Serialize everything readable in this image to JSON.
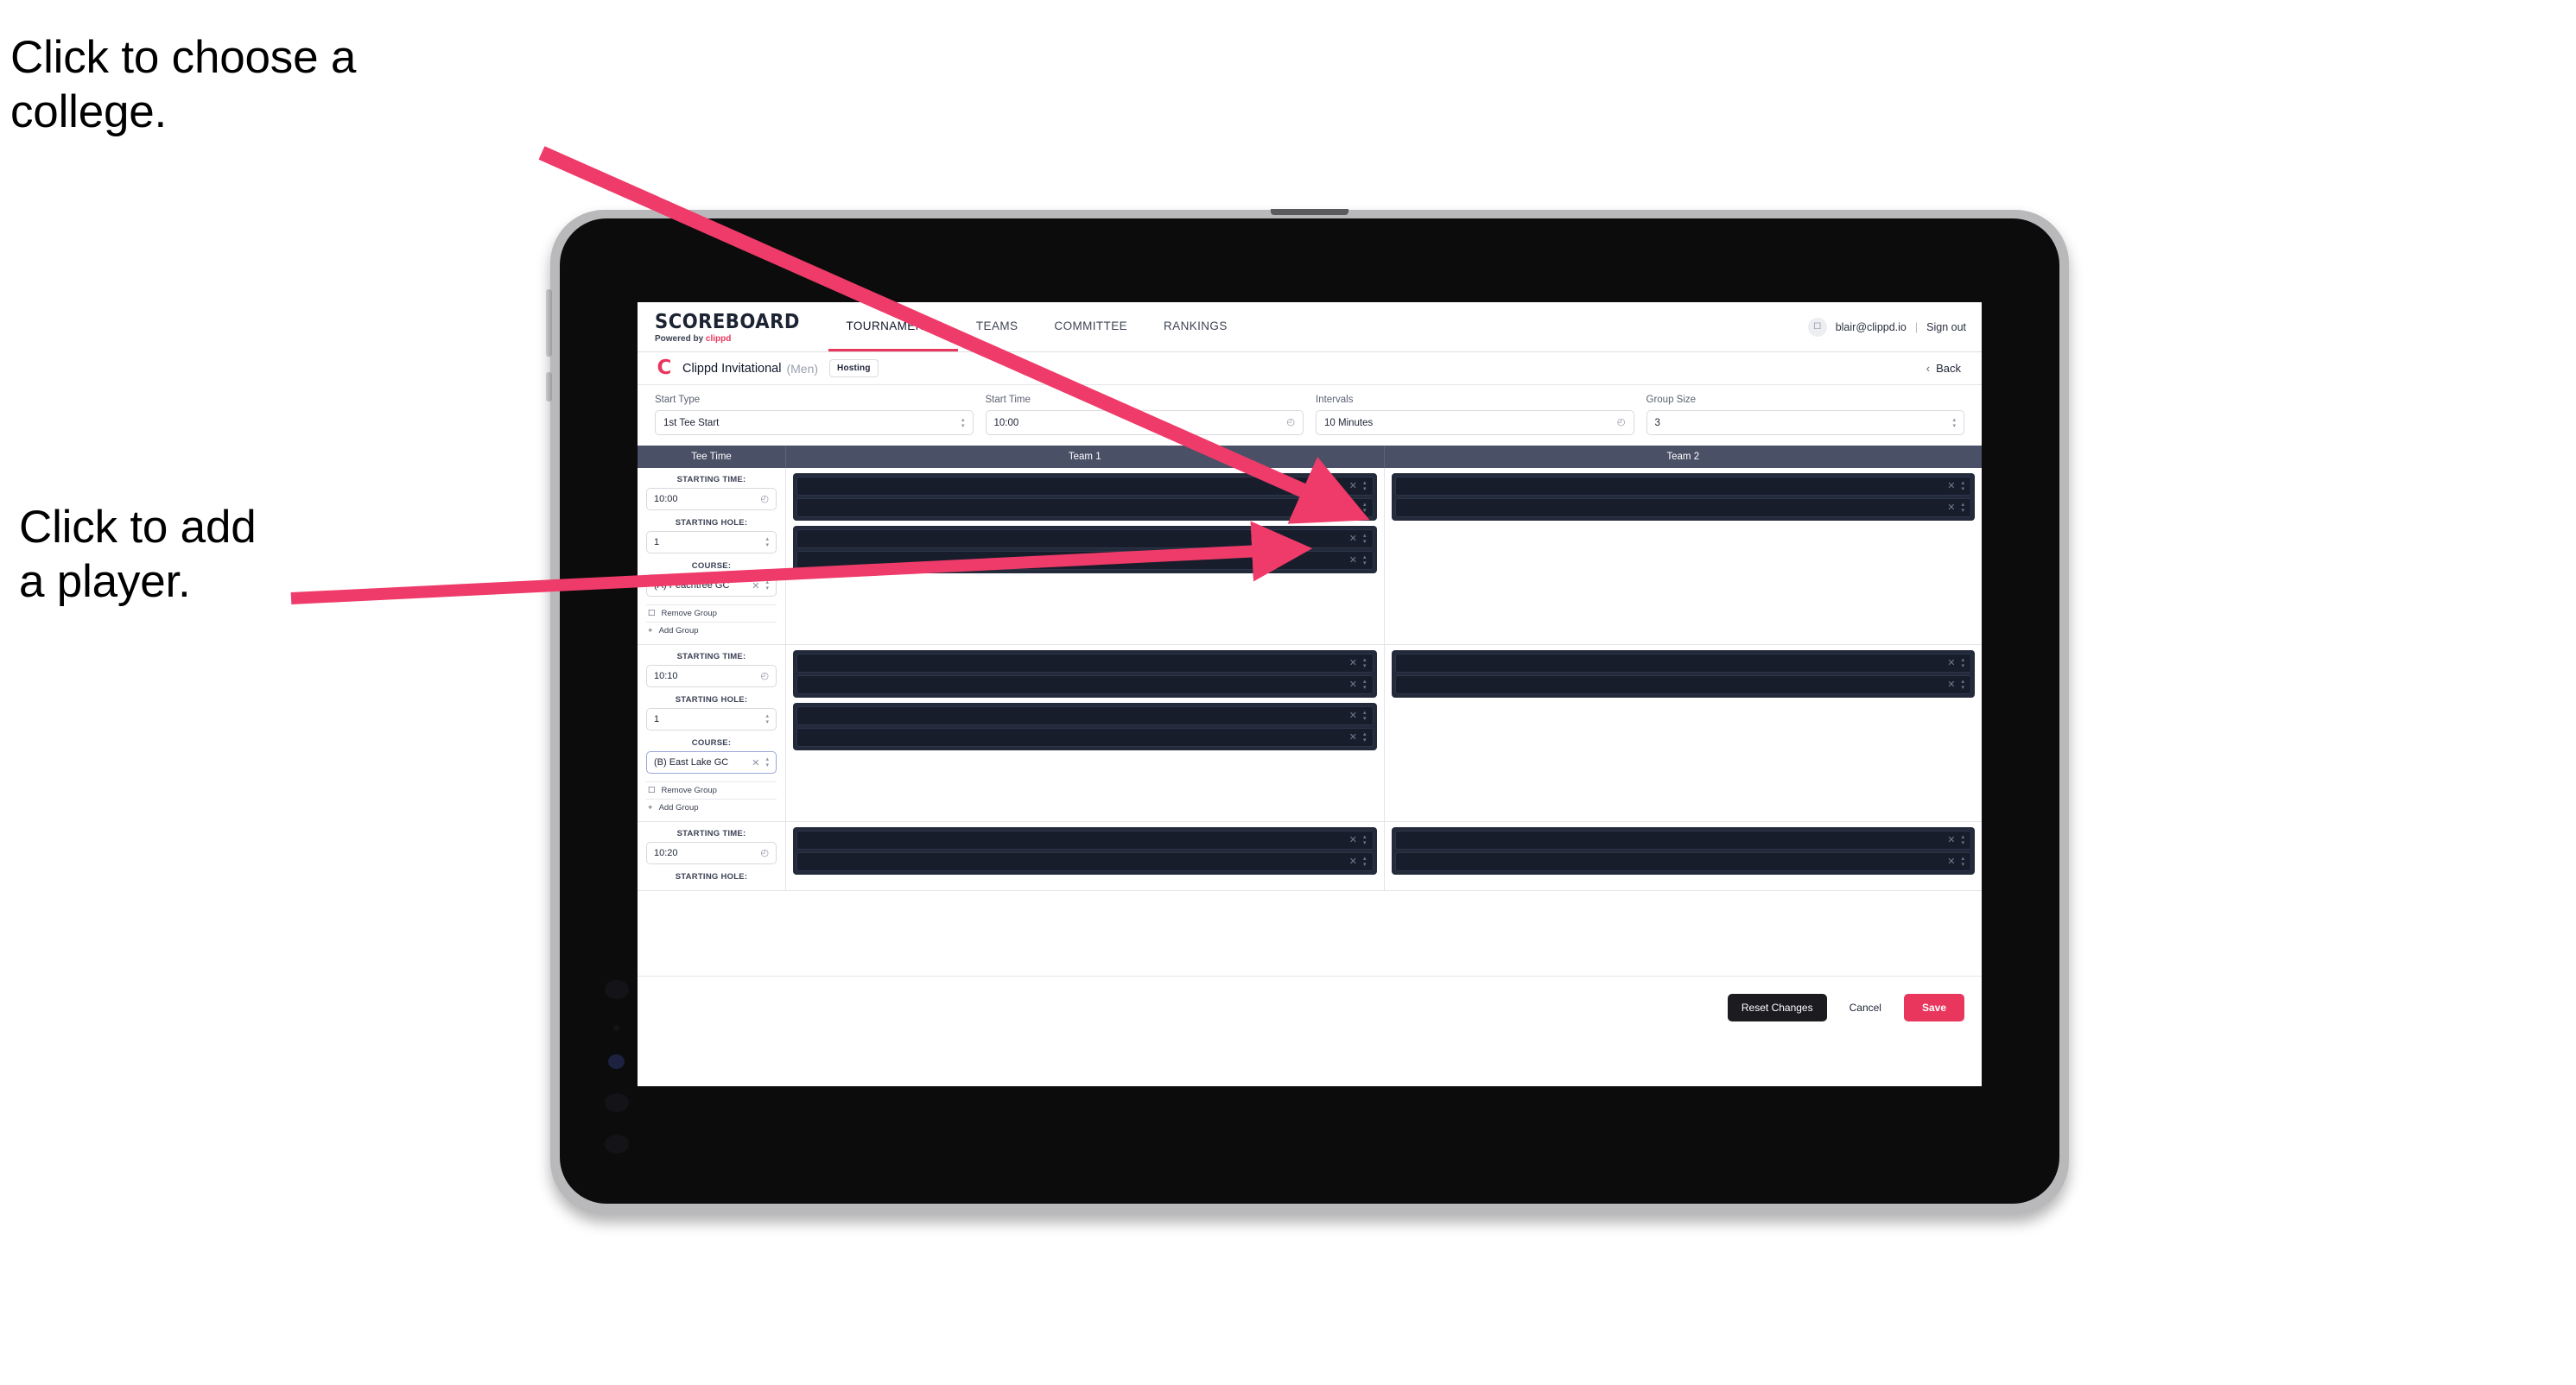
{
  "annotations": {
    "college": "Click to choose a\ncollege.",
    "player": "Click to add\na player.",
    "arrow_color": "#ef3b69"
  },
  "app": {
    "brand": {
      "name": "SCOREBOARD",
      "powered_prefix": "Powered by ",
      "powered_brand": "clippd"
    },
    "nav": [
      {
        "label": "TOURNAMENTS",
        "active": true
      },
      {
        "label": "TEAMS",
        "active": false
      },
      {
        "label": "COMMITTEE",
        "active": false
      },
      {
        "label": "RANKINGS",
        "active": false
      }
    ],
    "user": {
      "avatar_icon": "user-icon",
      "email": "blair@clippd.io",
      "separator": "|",
      "sign_out": "Sign out"
    },
    "tournament": {
      "logo_icon": "clippd-c-icon",
      "name": "Clippd Invitational",
      "gender": "(Men)",
      "badge": "Hosting",
      "back_label": "Back",
      "back_icon": "chevron-left-icon"
    },
    "controls": [
      {
        "label": "Start Type",
        "value": "1st Tee Start",
        "icon": "stepper-icon",
        "name": "start-type"
      },
      {
        "label": "Start Time",
        "value": "10:00",
        "icon": "clock-icon",
        "name": "start-time"
      },
      {
        "label": "Intervals",
        "value": "10 Minutes",
        "icon": "clock-icon",
        "name": "intervals"
      },
      {
        "label": "Group Size",
        "value": "3",
        "icon": "stepper-icon",
        "name": "group-size"
      }
    ],
    "table": {
      "headers": {
        "tee_time": "Tee Time",
        "team1": "Team 1",
        "team2": "Team 2"
      },
      "field_labels": {
        "time": "STARTING TIME:",
        "hole": "STARTING HOLE:",
        "course": "COURSE:"
      },
      "group_actions": {
        "remove": "Remove Group",
        "remove_icon": "trash-icon",
        "add": "Add Group",
        "add_icon": "plus-icon"
      },
      "row_icons": {
        "clear": "x-icon",
        "stepper": "stepper-icon"
      },
      "groups": [
        {
          "starting_time": "10:00",
          "starting_hole": "1",
          "course": "(A) Peachtree GC",
          "course_focused": false,
          "team1": [
            {
              "players": 2
            },
            {
              "players": 2
            }
          ],
          "team2": [
            {
              "players": 2
            }
          ]
        },
        {
          "starting_time": "10:10",
          "starting_hole": "1",
          "course": "(B) East Lake GC",
          "course_focused": true,
          "team1": [
            {
              "players": 2
            },
            {
              "players": 2
            }
          ],
          "team2": [
            {
              "players": 2
            }
          ]
        },
        {
          "starting_time": "10:20",
          "starting_hole": "",
          "course": "",
          "course_focused": false,
          "team1": [
            {
              "players": 2
            }
          ],
          "team2": [
            {
              "players": 2
            }
          ]
        }
      ]
    },
    "footer": {
      "reset": "Reset Changes",
      "cancel": "Cancel",
      "save": "Save"
    },
    "colors": {
      "accent": "#e8365d",
      "header_bar": "#4a5066",
      "card": "#232a3a",
      "row": "#171d2b"
    }
  }
}
